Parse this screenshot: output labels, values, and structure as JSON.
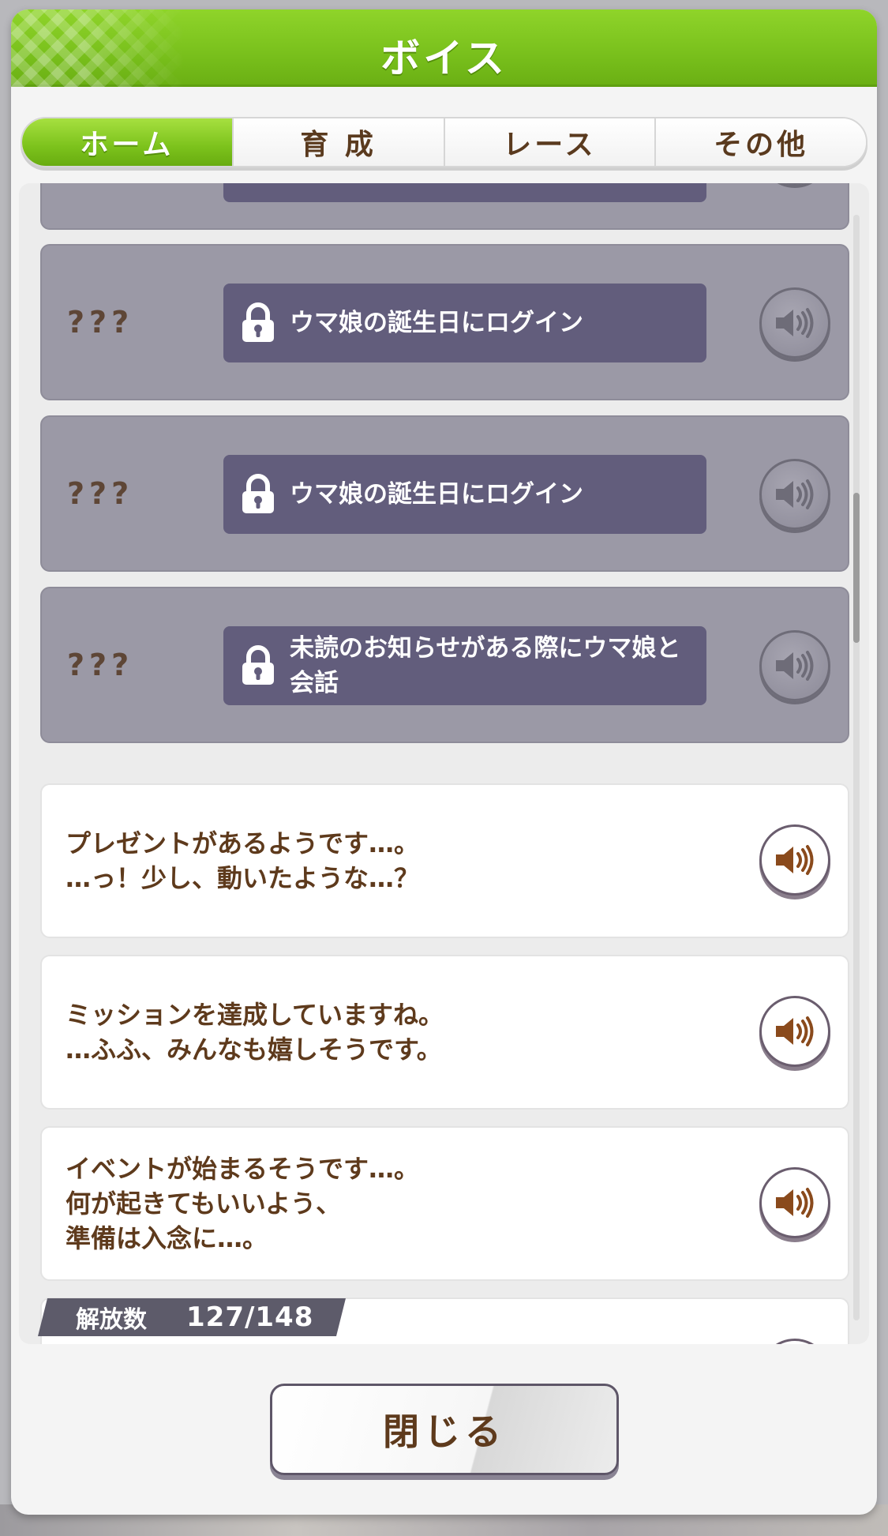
{
  "header": {
    "title": "ボイス"
  },
  "tabs": [
    {
      "label": "ホーム",
      "active": true
    },
    {
      "label": "育 成",
      "active": false
    },
    {
      "label": "レース",
      "active": false
    },
    {
      "label": "その他",
      "active": false
    }
  ],
  "locked_items": [
    {
      "name": "???",
      "condition": "ウマ娘の誕生日にログイン"
    },
    {
      "name": "???",
      "condition": "ウマ娘の誕生日にログイン"
    },
    {
      "name": "???",
      "condition": "未読のお知らせがある際にウマ娘と会話"
    }
  ],
  "voice_items": [
    {
      "lines": [
        "プレゼントがあるようです…。",
        "…っ！少し、動いたような…？"
      ]
    },
    {
      "lines": [
        "ミッションを達成していますね。",
        "…ふふ、みんなも嬉しそうです。"
      ]
    },
    {
      "lines": [
        "イベントが始まるそうです…。",
        "何が起きてもいいよう、",
        "準備は入念に…。"
      ]
    }
  ],
  "unlock": {
    "label": "解放数",
    "count": "127/148"
  },
  "close_button": {
    "label": "閉じる"
  },
  "colors": {
    "header_green": "#79c01c",
    "locked_card": "#9b99a6",
    "condition_bg": "#625d7c",
    "text_brown": "#5e3a1c"
  }
}
